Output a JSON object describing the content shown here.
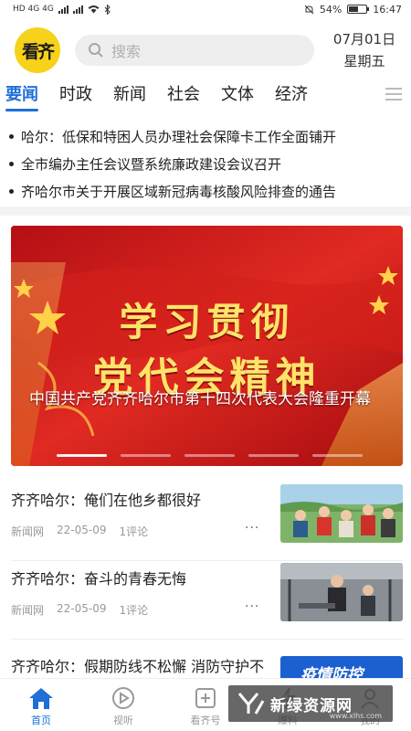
{
  "status_bar": {
    "left_text": "HD 4G 4G",
    "battery": "54%",
    "battery_level": 0.54,
    "time": "16:47"
  },
  "header": {
    "logo_text": "看齐",
    "search_placeholder": "搜索",
    "date": "07月01日",
    "weekday": "星期五"
  },
  "tabs": [
    "要闻",
    "时政",
    "新闻",
    "社会",
    "文体",
    "经济"
  ],
  "active_tab_index": 0,
  "headlines": [
    "哈尔：低保和特困人员办理社会保障卡工作全面铺开",
    "全市编办主任会议暨系统廉政建设会议召开",
    "齐哈尔市关于开展区域新冠病毒核酸风险排查的通告"
  ],
  "banner": {
    "title_line1": "学习贯彻",
    "title_line2": "党代会精神",
    "caption": "中国共产党齐齐哈尔市第十四次代表大会隆重开幕",
    "slide_count": 5,
    "active_slide": 0
  },
  "news": [
    {
      "title": "齐齐哈尔：俺们在他乡都很好",
      "source": "新闻网",
      "date": "22-05-09",
      "comments": "1评论",
      "more": "···",
      "thumb": "group-photo"
    },
    {
      "title": "齐齐哈尔：奋斗的青春无悔",
      "source": "新闻网",
      "date": "22-05-09",
      "comments": "1评论",
      "more": "···",
      "thumb": "gym-photo"
    },
    {
      "title": "齐齐哈尔：假期防线不松懈 消防守护不打烊",
      "source": "",
      "date": "",
      "comments": "",
      "more": "",
      "thumb": "epidemic-poster",
      "thumb_text": "疫情防控"
    }
  ],
  "bottom_nav": [
    {
      "label": "首页",
      "icon": "home-icon",
      "active": true
    },
    {
      "label": "视听",
      "icon": "play-icon",
      "active": false
    },
    {
      "label": "看齐号",
      "icon": "plus-square-icon",
      "active": false
    },
    {
      "label": "爆料",
      "icon": "lightning-icon",
      "active": false
    },
    {
      "label": "我的",
      "icon": "user-icon",
      "active": false
    }
  ],
  "watermark": {
    "text": "新绿资源网",
    "sub": "www.xlhs.com"
  },
  "colors": {
    "accent": "#1f6fd8",
    "banner_red": "#c8161b",
    "banner_gold": "#ffe36a",
    "logo_yellow": "#f7d21a"
  }
}
